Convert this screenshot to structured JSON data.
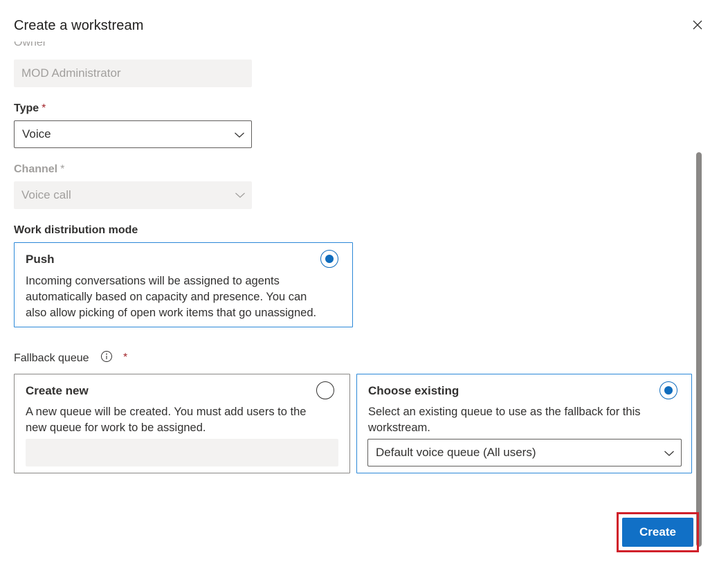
{
  "dialog": {
    "title": "Create a workstream"
  },
  "owner": {
    "label": "Owner",
    "value": "MOD Administrator"
  },
  "type_field": {
    "label": "Type",
    "required_mark": "*",
    "value": "Voice"
  },
  "channel_field": {
    "label": "Channel",
    "required_mark": "*",
    "value": "Voice call"
  },
  "work_distribution": {
    "label": "Work distribution mode",
    "push": {
      "title": "Push",
      "desc_line1": "Incoming conversations will be assigned to agents",
      "desc_line2": "automatically based on capacity and presence. You can",
      "desc_line3": "also allow picking of open work items that go unassigned.",
      "selected": true
    }
  },
  "fallback_queue": {
    "label": "Fallback queue",
    "info_icon": "info-icon",
    "required_mark": "*",
    "create_new": {
      "title": "Create new",
      "desc_line1": "A new queue will be created. You must add users to the",
      "desc_line2": "new queue for work to be assigned.",
      "input_value": "",
      "selected": false
    },
    "choose_existing": {
      "title": "Choose existing",
      "desc_line1": "Select an existing queue to use as the fallback for this",
      "desc_line2": "workstream.",
      "selected_queue": "Default voice queue (All users)",
      "selected": true
    }
  },
  "footer": {
    "create_label": "Create"
  },
  "colors": {
    "accent": "#0f6cbd",
    "required": "#a4262c",
    "highlight": "#d0202a"
  }
}
